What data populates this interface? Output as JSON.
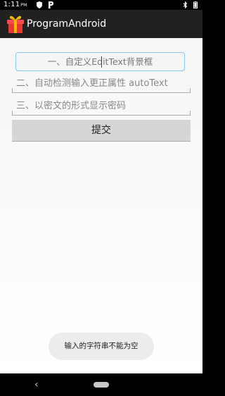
{
  "status_bar": {
    "time": "1:11",
    "ampm": "PM",
    "left_icons": [
      "shield-icon",
      "p-letter-icon"
    ],
    "right_icons": [
      "bluetooth-icon",
      "battery-icon"
    ]
  },
  "app_bar": {
    "title": "ProgramAndroid",
    "icon": "gift-icon",
    "background": "#212121"
  },
  "form": {
    "custom_edittext": {
      "placeholder": "一、自定义EditText背景框",
      "border_color": "#87c6f0"
    },
    "autotext": {
      "placeholder": "二、自动检测输入更正属性 autoText"
    },
    "password": {
      "placeholder": "三、以密文的形式显示密码"
    },
    "submit_label": "提交"
  },
  "toast": {
    "message": "输入的字符串不能为空"
  },
  "nav_bar": {
    "back_icon": "back-chevron-icon",
    "home_icon": "home-pill-icon"
  }
}
